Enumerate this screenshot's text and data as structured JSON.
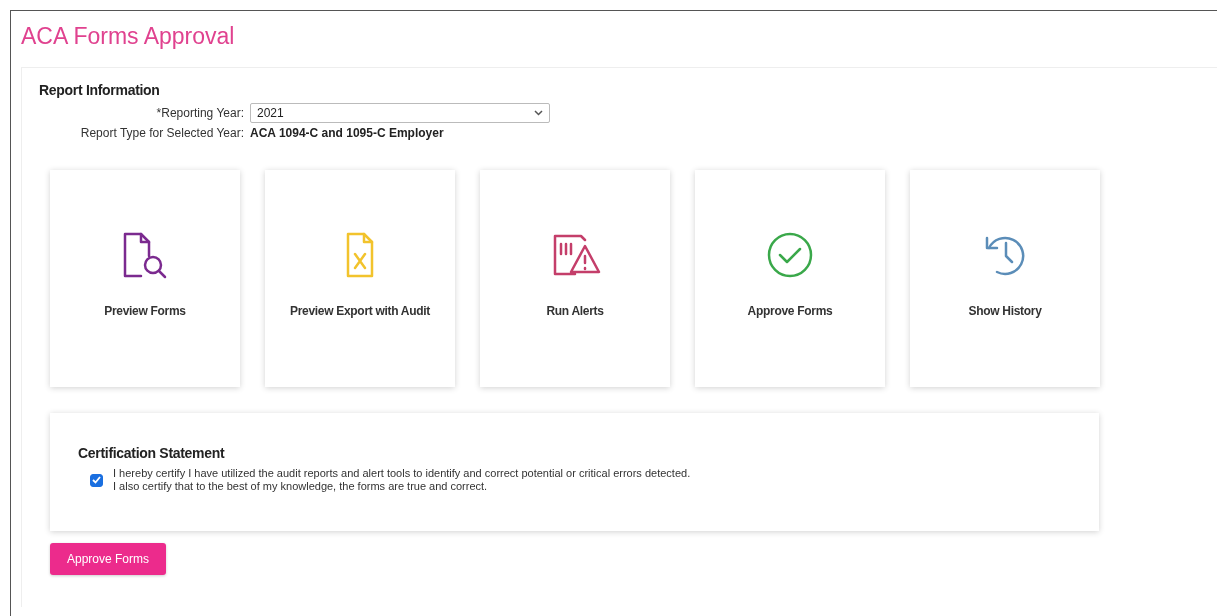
{
  "page": {
    "title": "ACA Forms Approval"
  },
  "report_information": {
    "heading": "Report Information",
    "reporting_year": {
      "label": "*Reporting Year:",
      "value": "2021"
    },
    "report_type": {
      "label": "Report Type for Selected Year:",
      "value": "ACA 1094-C and 1095-C Employer"
    }
  },
  "actions": [
    {
      "kind": "preview",
      "label": "Preview Forms",
      "color": "#7b2a8f"
    },
    {
      "kind": "export",
      "label": "Preview Export with Audit",
      "color": "#f2c32c"
    },
    {
      "kind": "alerts",
      "label": "Run Alerts",
      "color": "#c43e6a"
    },
    {
      "kind": "approve",
      "label": "Approve Forms",
      "color": "#3aa84a"
    },
    {
      "kind": "history",
      "label": "Show History",
      "color": "#5b8db8"
    }
  ],
  "certification": {
    "heading": "Certification Statement",
    "checked": true,
    "lines": [
      "I hereby certify I have utilized the audit reports and alert tools to identify and correct potential or critical errors detected.",
      "I also certify that to the best of my knowledge, the forms are true and correct."
    ]
  },
  "approve_button": "Approve Forms"
}
